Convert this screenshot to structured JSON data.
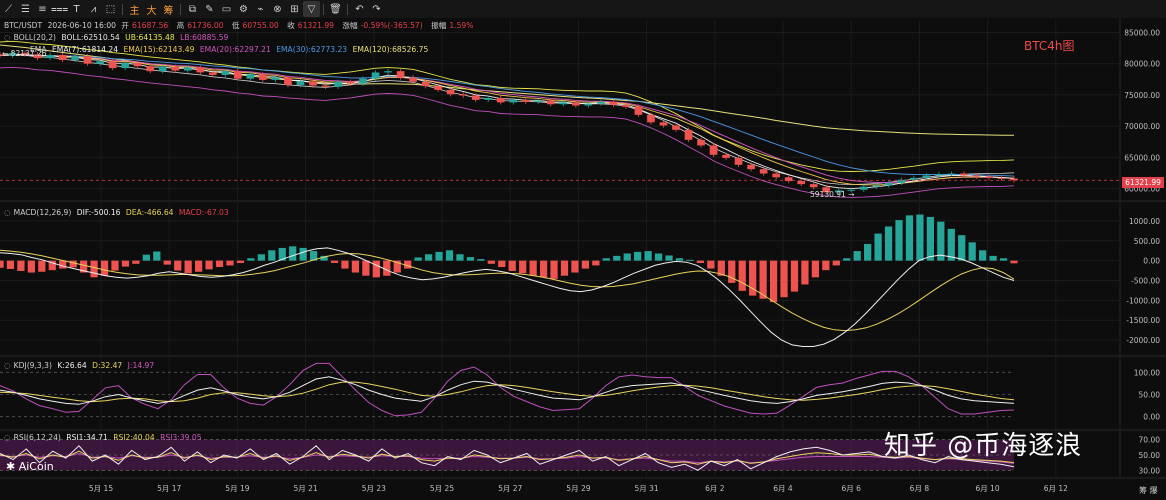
{
  "toolbar": {
    "tools": [
      {
        "name": "trend-line-tool",
        "glyph": "⟋"
      },
      {
        "name": "horizontal-lines-tool",
        "glyph": "☰"
      },
      {
        "name": "parallel-lines-tool",
        "glyph": "≡"
      },
      {
        "name": "channel-tool",
        "glyph": "⩶"
      },
      {
        "name": "text-tool",
        "glyph": "T"
      },
      {
        "name": "pattern-tool",
        "glyph": "⩘"
      },
      {
        "name": "measure-tool",
        "glyph": "⬚"
      }
    ],
    "periods": [
      "主",
      "大",
      "筹"
    ],
    "tools2": [
      {
        "name": "copy-tool",
        "glyph": "⧉"
      },
      {
        "name": "edit-tool",
        "glyph": "✎"
      },
      {
        "name": "alert-tool",
        "glyph": "▭"
      },
      {
        "name": "settings-tool",
        "glyph": "⚙"
      },
      {
        "name": "indicator-tool",
        "glyph": "⌁"
      },
      {
        "name": "link-tool",
        "glyph": "⊗"
      },
      {
        "name": "layout-tool",
        "glyph": "⊞"
      },
      {
        "name": "filter-tool",
        "glyph": "▽"
      },
      {
        "name": "delete-tool",
        "glyph": "🗑"
      },
      {
        "name": "undo-tool",
        "glyph": "↶"
      },
      {
        "name": "redo-tool",
        "glyph": "↷"
      }
    ]
  },
  "header": {
    "symbol": "BTC/USDT",
    "datetime": "2026-06-10 16:00",
    "open_label": "开",
    "open": "61687.56",
    "high_label": "高",
    "high": "61736.00",
    "low_label": "低",
    "low": "60755.00",
    "close_label": "收",
    "close": "61321.99",
    "change_label": "涨幅",
    "change": "-0.59%(-365.57)",
    "amp_label": "振幅",
    "amp": "1.59%"
  },
  "boll": {
    "name": "BOLL(20,2)",
    "values": [
      "BOLL:62510.54",
      "UB:64135.48",
      "LB:60885.59"
    ]
  },
  "ema": {
    "name": "EMA",
    "values": [
      "EMA(7):61814.24",
      "EMA(15):62143.49",
      "EMA(20):62297.21",
      "EMA(30):62773.23",
      "EMA(120):68526.75"
    ]
  },
  "macd": {
    "name": "MACD(12,26,9)",
    "values": [
      "DIF:-500.16",
      "DEA:-466.64",
      "MACD:-67.03"
    ]
  },
  "kdj": {
    "name": "KDJ(9,3,3)",
    "values": [
      "K:26.64",
      "D:32.47",
      "J:14.97"
    ]
  },
  "rsi": {
    "name": "RSI(6,12,24)",
    "values": [
      "RSI1:34.71",
      "RSI2:40.04",
      "RSI3:39.05"
    ]
  },
  "overlay": {
    "title": "BTC4h图",
    "last_price": "61321.99",
    "min_label": "59130.91 →",
    "max_label": "← 82137.26",
    "watermark": "知乎 @币海逐浪",
    "brand": "AiCoin",
    "corner": "筹 爆"
  },
  "colors": {
    "up": "#26a69a",
    "down": "#ef5350",
    "boll": "#d2d2d2",
    "ub": "#e6e84a",
    "lb": "#c04fc0",
    "ema7": "#f0f0f0",
    "ema15": "#f2c84b",
    "ema20": "#d455c4",
    "ema30": "#4a9ae6",
    "ema120": "#e8e079",
    "dif": "#f0f0f0",
    "dea": "#e8d45c",
    "k": "#f0f0f0",
    "d": "#e8d45c",
    "j": "#c04fc0",
    "rsi1": "#f0f0f0",
    "rsi2": "#e8d45c",
    "rsi3": "#c04fc0"
  },
  "chart_data": {
    "type": "line",
    "title": "BTC4h图",
    "x_ticks": [
      "5月 15",
      "5月 17",
      "5月 19",
      "5月 21",
      "5月 23",
      "5月 25",
      "5月 27",
      "5月 29",
      "5月 31",
      "6月 2",
      "6月 4",
      "6月 6",
      "6月 8",
      "6月 10",
      "6月 12"
    ],
    "price": {
      "yticks": [
        85000,
        80000,
        75000,
        70000,
        65000,
        60000
      ],
      "ylim": [
        58000,
        87000
      ],
      "close": [
        81300,
        81700,
        81500,
        80900,
        81400,
        80600,
        81200,
        80000,
        80400,
        79300,
        80100,
        79600,
        78800,
        79500,
        78900,
        79400,
        78600,
        78200,
        78800,
        77600,
        78300,
        77400,
        77800,
        76600,
        77200,
        76500,
        76300,
        77100,
        76800,
        77600,
        78600,
        78800,
        77800,
        77100,
        76400,
        75800,
        75100,
        74900,
        74200,
        74500,
        73800,
        74200,
        73900,
        74100,
        73500,
        73800,
        73300,
        73600,
        73900,
        73400,
        73100,
        71800,
        70600,
        70100,
        69400,
        67800,
        66900,
        65400,
        64900,
        63800,
        63100,
        62400,
        61800,
        61200,
        60700,
        60200,
        59400,
        59700,
        59800,
        60300,
        60500,
        60900,
        61400,
        61700,
        62100,
        62300,
        62400,
        62100,
        61900,
        61700,
        61600,
        61321.99
      ],
      "boll_mid": [
        81400,
        81500,
        81350,
        81100,
        81000,
        80750,
        80500,
        80200,
        80000,
        79700,
        79500,
        79250,
        79000,
        78800,
        78600,
        78400,
        78200,
        77900,
        77700,
        77400,
        77200,
        76900,
        76800,
        76600,
        76450,
        76300,
        76200,
        76400,
        76600,
        76900,
        77200,
        77300,
        77200,
        77000,
        76500,
        75950,
        75400,
        75000,
        74550,
        74400,
        74100,
        74000,
        73950,
        73900,
        73750,
        73650,
        73600,
        73550,
        73550,
        73450,
        73200,
        72600,
        71800,
        70900,
        69900,
        68800,
        67700,
        66500,
        65600,
        64800,
        64000,
        63300,
        62700,
        62200,
        61700,
        61300,
        60900,
        60700,
        60650,
        60700,
        60800,
        61000,
        61250,
        61500,
        61800,
        62050,
        62200,
        62300,
        62350,
        62400,
        62420,
        62510.54
      ],
      "ema120": [
        83000,
        82800,
        82600,
        82300,
        82050,
        81800,
        81550,
        81300,
        81050,
        80800,
        80550,
        80250,
        80000,
        79750,
        79500,
        79250,
        79000,
        78750,
        78500,
        78250,
        78050,
        77800,
        77600,
        77400,
        77200,
        77050,
        76900,
        76800,
        76750,
        76750,
        76800,
        76800,
        76750,
        76700,
        76550,
        76400,
        76200,
        76000,
        75800,
        75650,
        75500,
        75350,
        75200,
        75050,
        74900,
        74750,
        74600,
        74500,
        74400,
        74250,
        74100,
        73950,
        73750,
        73500,
        73250,
        73000,
        72750,
        72450,
        72150,
        71850,
        71550,
        71250,
        70900,
        70600,
        70300,
        70000,
        69750,
        69550,
        69400,
        69250,
        69150,
        69050,
        68950,
        68850,
        68780,
        68720,
        68680,
        68640,
        68600,
        68570,
        68550,
        68526.75
      ]
    },
    "macd": {
      "yticks": [
        1000,
        500,
        0,
        -500,
        -1000,
        -1500,
        -2000
      ],
      "ylim": [
        -2400,
        1400
      ],
      "hist": [
        -180,
        -210,
        -260,
        -300,
        -280,
        -240,
        -200,
        -170,
        -300,
        -420,
        -380,
        -250,
        -150,
        -80,
        150,
        230,
        -100,
        -250,
        -320,
        -280,
        -220,
        -160,
        -120,
        -60,
        60,
        160,
        260,
        320,
        360,
        320,
        240,
        120,
        -60,
        -200,
        -300,
        -380,
        -420,
        -380,
        -300,
        -200,
        80,
        160,
        220,
        260,
        160,
        90,
        40,
        -80,
        -160,
        -260,
        -320,
        -380,
        -420,
        -460,
        -380,
        -300,
        -200,
        -120,
        60,
        120,
        180,
        220,
        240,
        180,
        130,
        60,
        20,
        -60,
        -200,
        -380,
        -560,
        -760,
        -880,
        -960,
        -1040,
        -920,
        -780,
        -600,
        -420,
        -240,
        -120,
        60,
        240,
        420,
        680,
        860,
        1020,
        1140,
        1160,
        1100,
        980,
        800,
        640,
        460,
        260,
        120,
        60,
        -67.03
      ],
      "dif": [
        200,
        180,
        150,
        80,
        20,
        -60,
        -140,
        -200,
        -260,
        -320,
        -380,
        -420,
        -440,
        -420,
        -380,
        -320,
        -280,
        -320,
        -360,
        -400,
        -420,
        -400,
        -360,
        -300,
        -220,
        -120,
        -40,
        60,
        150,
        240,
        300,
        320,
        260,
        180,
        80,
        -40,
        -160,
        -280,
        -380,
        -440,
        -480,
        -460,
        -420,
        -360,
        -300,
        -250,
        -220,
        -250,
        -300,
        -380,
        -460,
        -540,
        -620,
        -700,
        -760,
        -780,
        -740,
        -660,
        -560,
        -440,
        -320,
        -220,
        -120,
        -60,
        -20,
        -40,
        -120,
        -280,
        -480,
        -720,
        -980,
        -1260,
        -1540,
        -1800,
        -2000,
        -2120,
        -2160,
        -2160,
        -2100,
        -1980,
        -1800,
        -1580,
        -1320,
        -1040,
        -760,
        -480,
        -220,
        0,
        100,
        140,
        100,
        40,
        -60,
        -180,
        -300,
        -420,
        -500.16
      ],
      "dea": [
        260,
        240,
        210,
        170,
        120,
        60,
        0,
        -60,
        -120,
        -180,
        -240,
        -290,
        -330,
        -360,
        -370,
        -370,
        -360,
        -350,
        -350,
        -360,
        -370,
        -380,
        -380,
        -370,
        -340,
        -300,
        -250,
        -180,
        -110,
        -40,
        40,
        110,
        160,
        180,
        170,
        130,
        70,
        0,
        -80,
        -160,
        -240,
        -300,
        -340,
        -360,
        -360,
        -350,
        -330,
        -320,
        -320,
        -330,
        -360,
        -400,
        -450,
        -510,
        -570,
        -620,
        -650,
        -660,
        -650,
        -620,
        -580,
        -520,
        -460,
        -400,
        -340,
        -290,
        -260,
        -270,
        -320,
        -400,
        -520,
        -660,
        -820,
        -990,
        -1160,
        -1320,
        -1460,
        -1580,
        -1680,
        -1740,
        -1760,
        -1740,
        -1690,
        -1600,
        -1480,
        -1340,
        -1180,
        -1000,
        -820,
        -640,
        -480,
        -340,
        -240,
        -180,
        -200,
        -300,
        -466.64
      ]
    },
    "kdj": {
      "yticks": [
        100,
        50,
        0
      ],
      "ylim": [
        -30,
        130
      ],
      "k": [
        60,
        55,
        48,
        40,
        35,
        30,
        28,
        35,
        45,
        50,
        42,
        36,
        30,
        35,
        48,
        60,
        65,
        58,
        50,
        44,
        40,
        45,
        55,
        70,
        85,
        90,
        82,
        72,
        60,
        50,
        42,
        38,
        35,
        45,
        60,
        72,
        80,
        78,
        70,
        62,
        55,
        48,
        42,
        40,
        38,
        45,
        55,
        65,
        70,
        72,
        74,
        76,
        70,
        62,
        55,
        48,
        42,
        36,
        32,
        30,
        34,
        40,
        48,
        52,
        56,
        62,
        68,
        75,
        78,
        76,
        70,
        60,
        48,
        40,
        36,
        34,
        32,
        30
      ],
      "d": [
        55,
        54,
        52,
        48,
        44,
        40,
        36,
        34,
        36,
        40,
        42,
        40,
        36,
        34,
        36,
        42,
        50,
        54,
        54,
        51,
        47,
        45,
        47,
        53,
        62,
        72,
        78,
        78,
        74,
        68,
        62,
        55,
        48,
        46,
        50,
        56,
        64,
        70,
        72,
        70,
        66,
        61,
        56,
        52,
        48,
        46,
        48,
        53,
        58,
        63,
        67,
        70,
        71,
        69,
        65,
        60,
        55,
        50,
        45,
        41,
        38,
        37,
        39,
        42,
        46,
        50,
        55,
        61,
        66,
        69,
        70,
        68,
        63,
        57,
        51,
        46,
        41,
        38
      ],
      "j": [
        70,
        58,
        40,
        25,
        18,
        10,
        12,
        38,
        65,
        70,
        42,
        28,
        18,
        38,
        72,
        95,
        95,
        65,
        42,
        30,
        26,
        45,
        72,
        104,
        120,
        120,
        90,
        60,
        32,
        14,
        2,
        4,
        10,
        42,
        80,
        104,
        112,
        94,
        66,
        46,
        34,
        22,
        14,
        16,
        18,
        42,
        70,
        90,
        94,
        90,
        88,
        88,
        68,
        48,
        36,
        24,
        16,
        8,
        6,
        8,
        26,
        46,
        66,
        72,
        76,
        86,
        94,
        102,
        102,
        90,
        70,
        44,
        18,
        6,
        6,
        10,
        14,
        14.97
      ]
    },
    "rsi": {
      "yticks": [
        70,
        50,
        30
      ],
      "ylim": [
        20,
        80
      ],
      "rsi1": [
        52,
        44,
        58,
        40,
        55,
        46,
        62,
        42,
        50,
        38,
        56,
        44,
        48,
        60,
        42,
        54,
        40,
        50,
        46,
        58,
        44,
        52,
        38,
        48,
        62,
        44,
        56,
        50,
        42,
        58,
        46,
        52,
        40,
        36,
        48,
        44,
        56,
        50,
        40,
        46,
        52,
        38,
        44,
        50,
        56,
        42,
        48,
        36,
        44,
        52,
        40,
        34,
        38,
        30,
        42,
        36,
        44,
        32,
        40,
        48,
        54,
        58,
        60,
        56,
        50,
        52,
        54,
        48,
        46,
        50,
        44,
        40,
        48,
        44,
        42,
        40,
        38,
        34.71
      ],
      "rsi2": [
        50,
        47,
        52,
        45,
        50,
        47,
        55,
        46,
        48,
        43,
        50,
        46,
        47,
        53,
        46,
        50,
        44,
        48,
        47,
        52,
        46,
        49,
        43,
        47,
        53,
        47,
        51,
        49,
        46,
        51,
        48,
        49,
        44,
        42,
        46,
        45,
        50,
        48,
        45,
        46,
        48,
        44,
        45,
        47,
        50,
        46,
        47,
        43,
        45,
        48,
        44,
        40,
        41,
        38,
        42,
        40,
        43,
        39,
        41,
        45,
        48,
        51,
        53,
        52,
        50,
        50,
        51,
        48,
        47,
        48,
        46,
        44,
        46,
        45,
        44,
        43,
        42,
        40.04
      ],
      "rsi3": [
        49,
        48,
        50,
        47,
        49,
        48,
        52,
        47,
        48,
        46,
        49,
        47,
        47,
        50,
        47,
        49,
        46,
        47,
        47,
        49,
        47,
        48,
        45,
        47,
        50,
        48,
        49,
        48,
        47,
        49,
        48,
        48,
        46,
        45,
        46,
        46,
        48,
        47,
        46,
        46,
        47,
        45,
        45,
        46,
        48,
        46,
        46,
        44,
        45,
        46,
        44,
        42,
        42,
        40,
        42,
        41,
        42,
        40,
        41,
        43,
        45,
        47,
        48,
        48,
        48,
        48,
        48,
        47,
        46,
        47,
        45,
        44,
        45,
        44,
        43,
        42,
        41,
        39.05
      ]
    }
  }
}
